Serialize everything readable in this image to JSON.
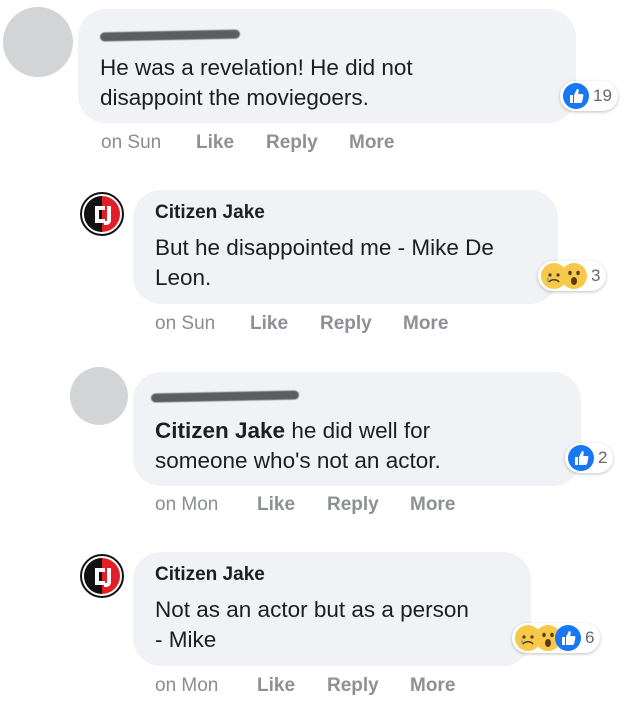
{
  "comments": [
    {
      "author": "",
      "text_lines": [
        "He was a revelation! He did not",
        "disappoint the moviegoers."
      ],
      "reaction_count": "19",
      "reactions": [
        "like-icon"
      ],
      "time": "on Sun",
      "like": "Like",
      "reply": "Reply",
      "more": "More"
    },
    {
      "author": "Citizen Jake",
      "text_lines": [
        "But he disappointed me - Mike De",
        "Leon."
      ],
      "reaction_count": "3",
      "reactions": [
        "sad-icon",
        "wow-icon"
      ],
      "time": "on Sun",
      "like": "Like",
      "reply": "Reply",
      "more": "More"
    },
    {
      "author": "",
      "mention": "Citizen Jake",
      "text_lines": [
        " he did well for",
        "someone who's not an actor."
      ],
      "reaction_count": "2",
      "reactions": [
        "like-icon"
      ],
      "time": "on Mon",
      "like": "Like",
      "reply": "Reply",
      "more": "More"
    },
    {
      "author": "Citizen Jake",
      "text_lines": [
        "Not as an actor but as a person",
        "- Mike"
      ],
      "reaction_count": "6",
      "reactions": [
        "sad-icon",
        "wow-icon",
        "like-icon"
      ],
      "time": "on Mon",
      "like": "Like",
      "reply": "Reply",
      "more": "More"
    }
  ],
  "colors": {
    "like_blue": "#1877f2",
    "emoji_yellow": "#f7c94a",
    "bubble_bg": "#f0f2f5",
    "meta_gray": "#8a8d91",
    "logo_red": "#e41e26"
  }
}
